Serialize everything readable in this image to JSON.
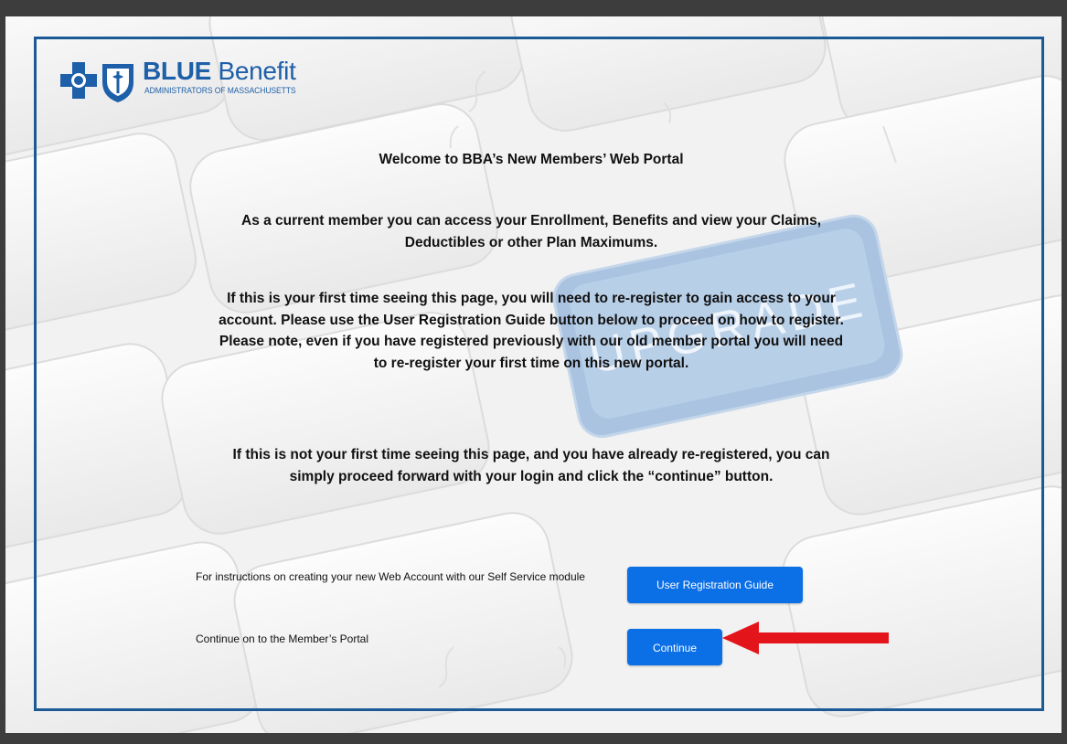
{
  "logo": {
    "brand_bold": "BLUE",
    "brand_light": " Benefit",
    "subtitle": "ADMINISTRATORS OF MASSACHUSETTS"
  },
  "background": {
    "key_text": "UPGRADE"
  },
  "content": {
    "title": "Welcome to BBA’s New Members’ Web Portal",
    "paragraph_1": "As a current member you can access your Enrollment, Benefits and view your Claims, Deductibles or other Plan Maximums.",
    "paragraph_2": "If this is your first time seeing this page, you will need to re-register to gain access to your account. Please use the User Registration Guide button below to proceed on how to register. Please note, even if you have registered previously with our old member portal you will need to re-register your first time on this new portal.",
    "paragraph_3": "If this is not your first time seeing this page, and you have already re-registered, you can simply proceed forward with your login and click the “continue” button."
  },
  "actions": {
    "guide_description": "For instructions on creating your new Web Account with our Self Service module",
    "guide_button": "User Registration Guide",
    "continue_description": "Continue on to the Member’s Portal",
    "continue_button": "Continue"
  },
  "colors": {
    "button": "#0b6fe6",
    "frame": "#1c5a96",
    "arrow": "#e4141b",
    "brand": "#1d5fa8"
  }
}
